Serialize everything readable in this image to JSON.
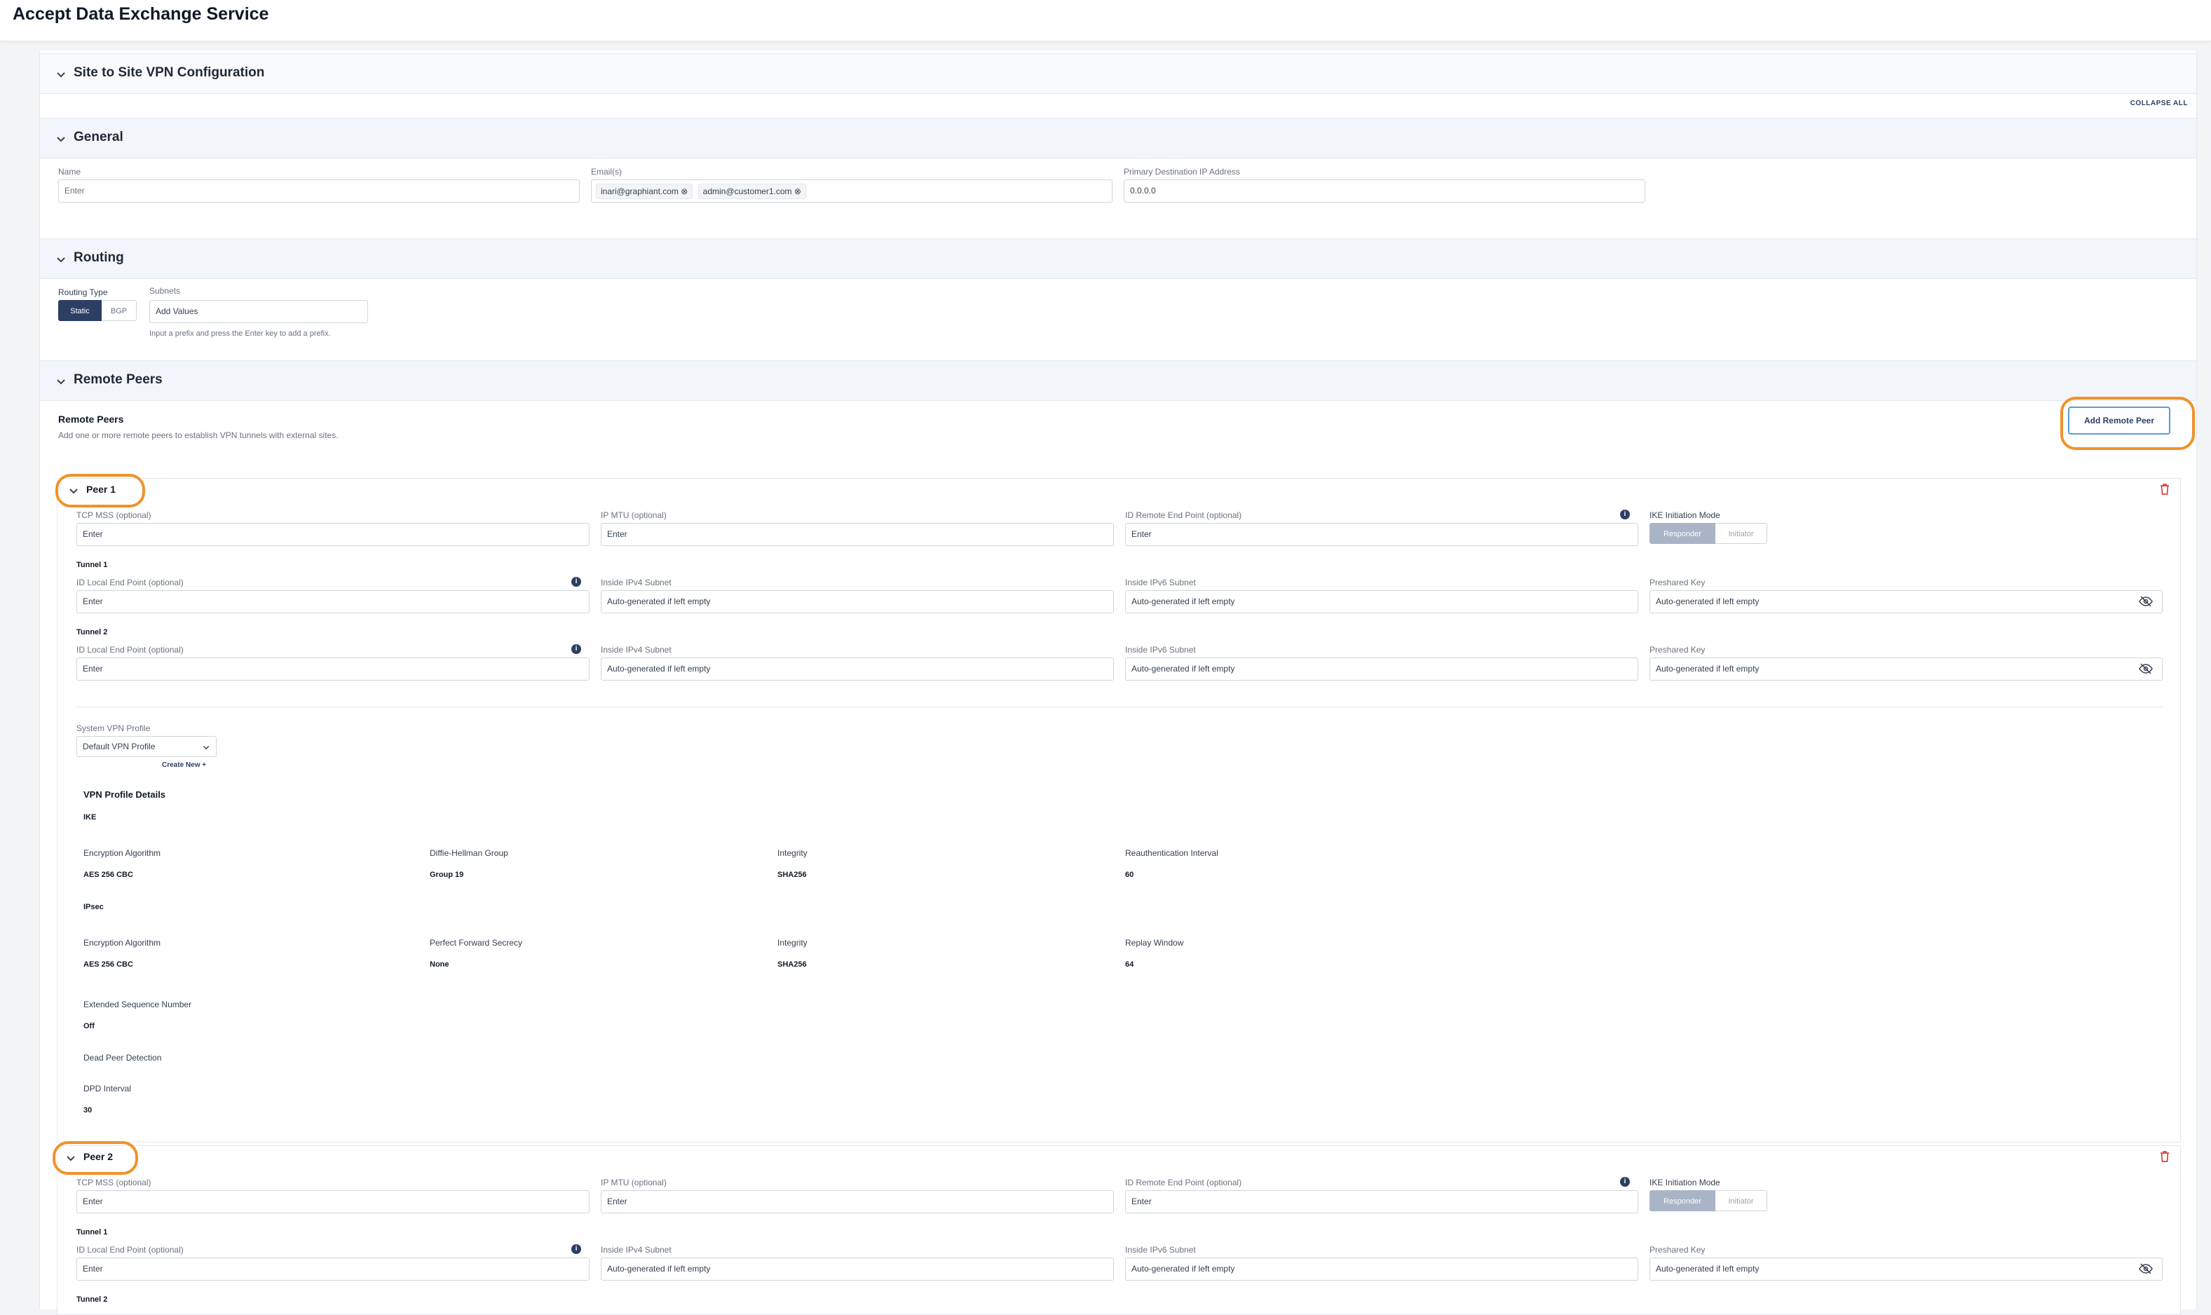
{
  "page": {
    "title": "Accept Data Exchange Service"
  },
  "sections": {
    "site_to_site": "Site to Site VPN Configuration",
    "collapse_all": "COLLAPSE ALL",
    "general": "General",
    "routing": "Routing",
    "remote_peers": "Remote Peers"
  },
  "general": {
    "name_label": "Name",
    "name_placeholder": "Enter",
    "emails_label": "Email(s)",
    "emails": [
      "inari@graphiant.com",
      "admin@customer1.com"
    ],
    "primary_ip_label": "Primary Destination IP Address",
    "primary_ip_value": "0.0.0.0"
  },
  "routing": {
    "type_label": "Routing Type",
    "type_options": [
      "Static",
      "BGP"
    ],
    "selected_type": "Static",
    "subnets_label": "Subnets",
    "subnets_placeholder": "Add Values",
    "subnets_hint": "Input a prefix and press the Enter key to add a prefix."
  },
  "remote_peers": {
    "heading": "Remote Peers",
    "description": "Add one or more remote peers to establish VPN tunnels with external sites.",
    "add_button": "Add Remote Peer"
  },
  "fields": {
    "tcp_mss": "TCP MSS (optional)",
    "ip_mtu": "IP MTU (optional)",
    "id_remote": "ID Remote End Point (optional)",
    "ike_mode": "IKE Initiation Mode",
    "ike_options": [
      "Responder",
      "Initiator"
    ],
    "id_local": "ID Local End Point (optional)",
    "inside_ipv4": "Inside IPv4 Subnet",
    "inside_ipv6": "Inside IPv6 Subnet",
    "preshared_key": "Preshared Key",
    "enter": "Enter",
    "auto": "Auto-generated if left empty",
    "tunnel1": "Tunnel 1",
    "tunnel2": "Tunnel 2"
  },
  "peers": [
    {
      "title": "Peer 1"
    },
    {
      "title": "Peer 2"
    }
  ],
  "vpn_profile": {
    "label": "System VPN Profile",
    "selected": "Default VPN Profile",
    "create_new": "Create New +",
    "details_title": "VPN Profile Details",
    "ike": {
      "title": "IKE",
      "items": [
        {
          "label": "Encryption Algorithm",
          "value": "AES 256 CBC"
        },
        {
          "label": "Diffie-Hellman Group",
          "value": "Group 19"
        },
        {
          "label": "Integrity",
          "value": "SHA256"
        },
        {
          "label": "Reauthentication Interval",
          "value": "60"
        }
      ]
    },
    "ipsec": {
      "title": "IPsec",
      "items": [
        {
          "label": "Encryption Algorithm",
          "value": "AES 256 CBC"
        },
        {
          "label": "Perfect Forward Secrecy",
          "value": "None"
        },
        {
          "label": "Integrity",
          "value": "SHA256"
        },
        {
          "label": "Replay Window",
          "value": "64"
        }
      ]
    },
    "esn_label": "Extended Sequence Number",
    "esn_value": "Off",
    "dpd_label": "Dead Peer Detection",
    "dpd_interval_label": "DPD Interval",
    "dpd_interval_value": "30"
  },
  "colors": {
    "primary": "#2c3e63",
    "highlight": "#f0922b",
    "danger": "#dc2626",
    "section_bg": "#f2f6fb"
  }
}
